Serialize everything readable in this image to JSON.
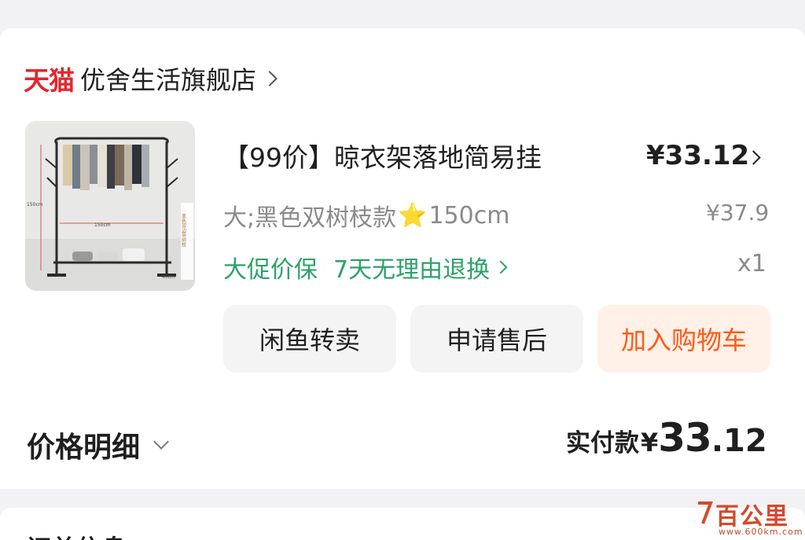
{
  "store": {
    "brand_logo": "天猫",
    "name": "优舍生活旗舰店",
    "chevron_icon": "chevron-right-icon"
  },
  "product": {
    "title": "【99价】晾衣架落地简易挂",
    "price": "¥33.12",
    "sku_text": "大;黑色双树枝款",
    "sku_emoji": "⭐",
    "sku_size": "150cm",
    "original_price": "¥37.9",
    "guarantee_1": "大促价保",
    "guarantee_2": "7天无理由退换",
    "quantity": "x1",
    "image_labels": {
      "height": "150cm",
      "width": "150cm",
      "depth": "40cm",
      "side_tag": "黑色双边带树枝"
    }
  },
  "actions": {
    "resell_label": "闲鱼转卖",
    "aftersale_label": "申请售后",
    "add_cart_label": "加入购物车"
  },
  "summary": {
    "detail_label": "价格明细",
    "paid_label": "实付款",
    "paid_currency": "¥",
    "paid_integer": "33",
    "paid_decimal": ".12"
  },
  "next_section": {
    "peek_text": "订单信息"
  },
  "watermark": {
    "main": "百公里",
    "sub": "www.600km.com"
  },
  "colors": {
    "tmall_red": "#e3262c",
    "guarantee_green": "#2aa26a",
    "cart_orange": "#ff5a16",
    "cart_bg": "#fff0e8"
  }
}
